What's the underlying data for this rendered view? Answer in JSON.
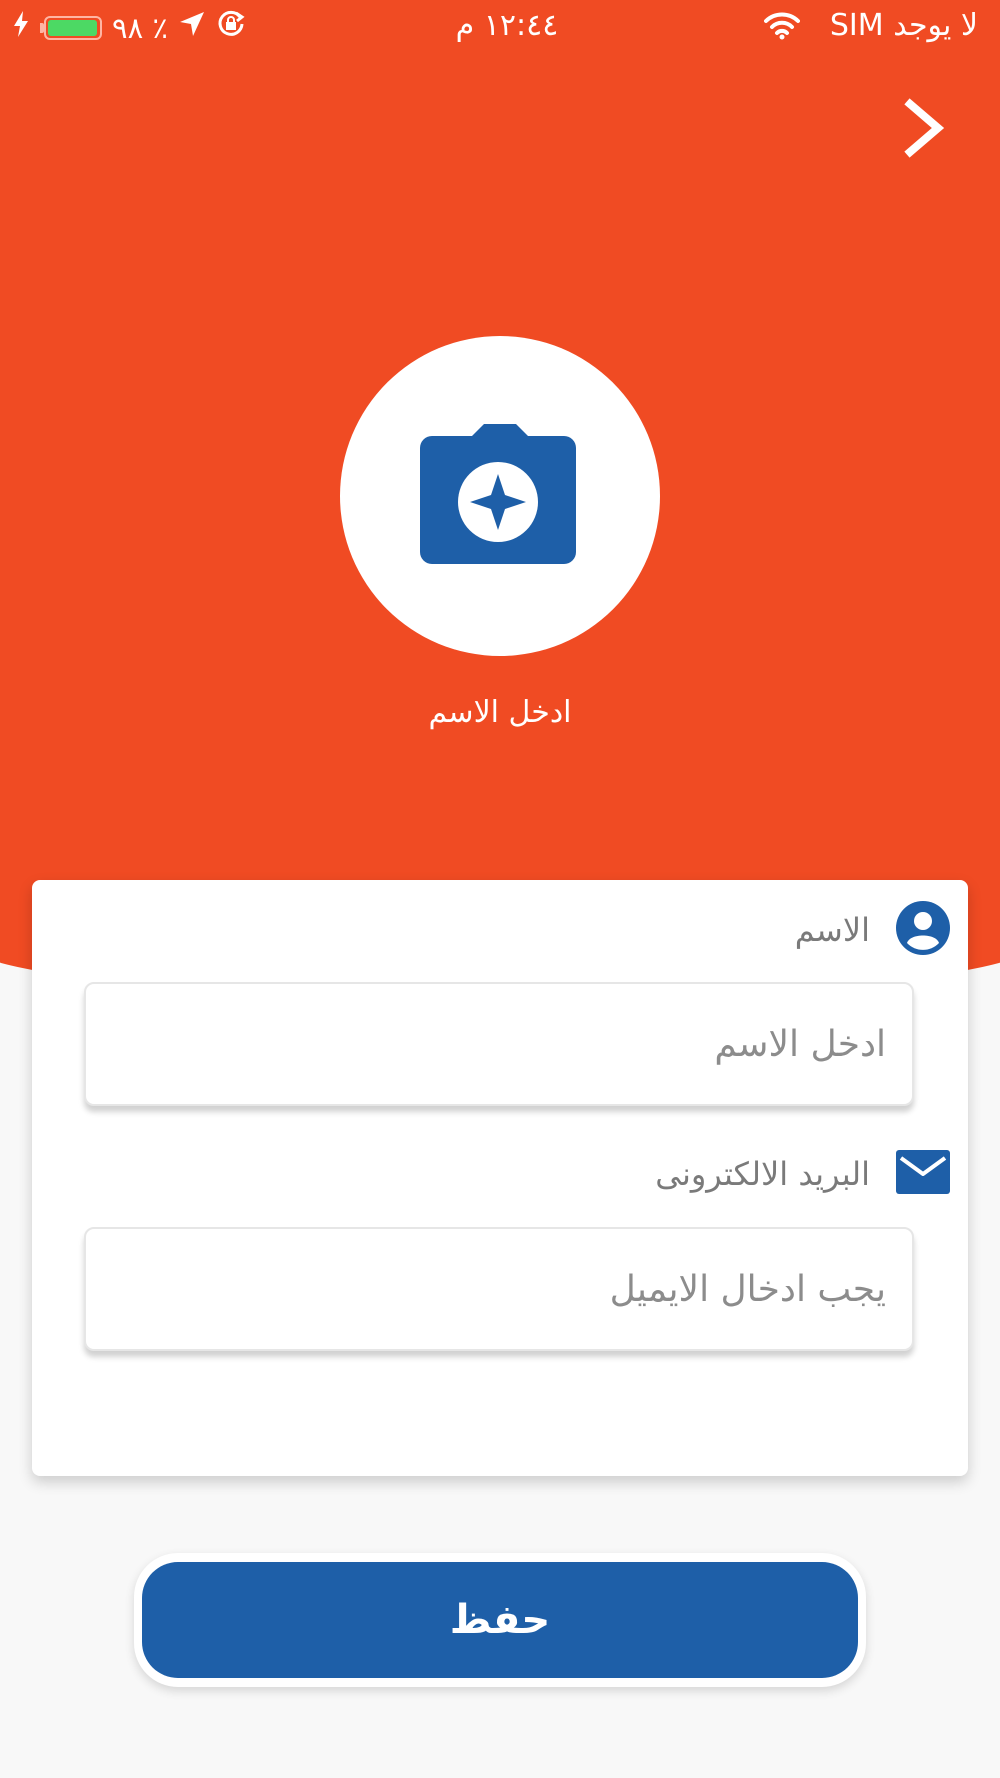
{
  "status_bar": {
    "carrier": "لا يوجد SIM",
    "time": "١٢:٤٤ م",
    "battery_text": "٪ ٩٨",
    "battery_level": 0.98
  },
  "colors": {
    "header": "#f04b23",
    "accent_blue": "#1e5fa8",
    "background": "#f8f8f8"
  },
  "header": {
    "back_icon": "chevron-right-icon",
    "avatar_icon": "camera-icon",
    "profile_name": "ادخل الاسم"
  },
  "form": {
    "name": {
      "label": "الاسم",
      "icon": "user-circle-icon",
      "value": "",
      "placeholder": "ادخل الاسم"
    },
    "email": {
      "label": "البريد الالكترونى",
      "icon": "envelope-icon",
      "value": "",
      "placeholder": "يجب ادخال الايميل"
    }
  },
  "save_button": {
    "label": "حفظ"
  }
}
